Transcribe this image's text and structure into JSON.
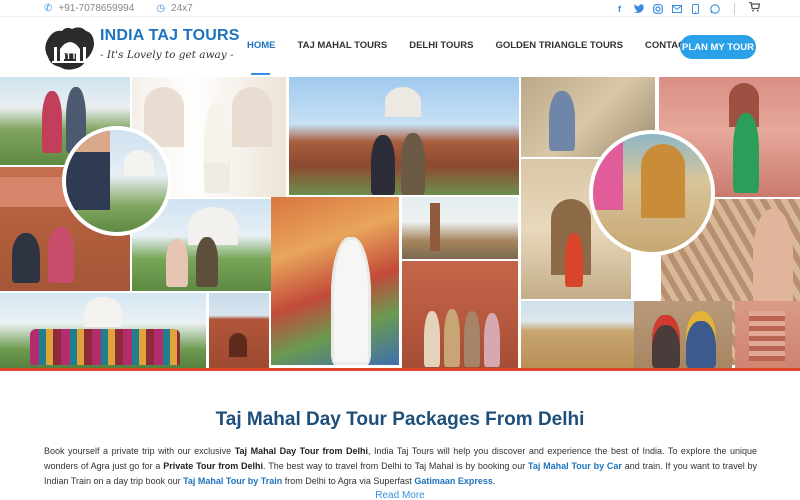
{
  "topbar": {
    "phone_icon": "phone-icon",
    "phone": "+91-7078659994",
    "clock_icon": "clock-icon",
    "hours": "24x7",
    "social": [
      "facebook-icon",
      "twitter-icon",
      "instagram-icon",
      "email-icon",
      "mobile-icon",
      "whatsapp-icon"
    ],
    "cart_icon": "cart-icon"
  },
  "logo": {
    "title": "INDIA TAJ TOURS",
    "tagline": "- It's Lovely to get away -"
  },
  "nav": {
    "items": [
      {
        "label": "HOME",
        "active": true
      },
      {
        "label": "TAJ MAHAL TOURS",
        "active": false
      },
      {
        "label": "DELHI TOURS",
        "active": false
      },
      {
        "label": "GOLDEN TRIANGLE TOURS",
        "active": false
      },
      {
        "label": "CONTACT US",
        "active": false
      }
    ],
    "cta": "PLAN MY TOUR"
  },
  "content": {
    "heading": "Taj Mahal Day Tour Packages From Delhi",
    "p1": "Book yourself a private trip with our exclusive ",
    "b1": "Taj Mahal Day Tour from Delhi",
    "p2": ", India Taj Tours will help you discover and experience the best of India. To explore the unique wonders of Agra just go for a ",
    "b2": "Private Tour from Delhi",
    "p3": ". The best way to travel from Delhi to Taj Mahal is by booking our ",
    "l1": "Taj Mahal Tour by Car",
    "p4": " and train. If you want to travel by Indian Train on a day trip book our ",
    "l2": "Taj Mahal Tour by Train",
    "p5": " from Delhi to Agra via Superfast ",
    "l3": "Gatimaan Express",
    "p6": ".",
    "read_more": "Read More"
  },
  "colors": {
    "brand_blue": "#1e73be",
    "cta_blue": "#29a0e8",
    "heading_navy": "#1d4f7a",
    "divider_red": "#e0452b"
  }
}
